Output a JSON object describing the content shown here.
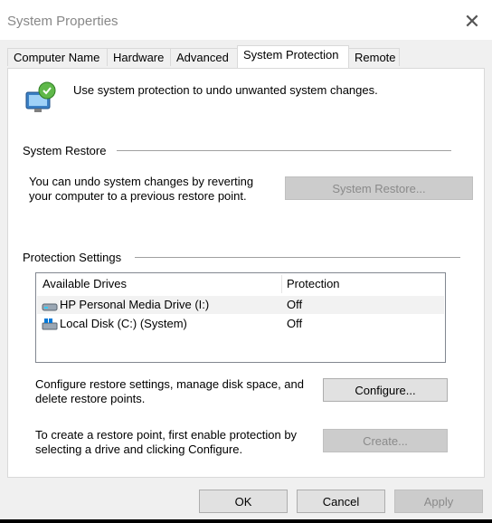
{
  "window": {
    "title": "System Properties"
  },
  "tabs": [
    {
      "label": "Computer Name"
    },
    {
      "label": "Hardware"
    },
    {
      "label": "Advanced"
    },
    {
      "label": "System Protection"
    },
    {
      "label": "Remote"
    }
  ],
  "header": {
    "text": "Use system protection to undo unwanted system changes."
  },
  "restore": {
    "group_label": "System Restore",
    "desc_line1": "You can undo system changes by reverting",
    "desc_line2": "your computer to a previous restore point.",
    "button_label": "System Restore..."
  },
  "protection": {
    "group_label": "Protection Settings",
    "col_drives": "Available Drives",
    "col_protection": "Protection",
    "drives": [
      {
        "name": "HP Personal Media Drive (I:)",
        "protection": "Off",
        "icon": "removable-drive-icon"
      },
      {
        "name": "Local Disk (C:) (System)",
        "protection": "Off",
        "icon": "system-drive-icon"
      }
    ],
    "configure_line1": "Configure restore settings, manage disk space, and",
    "configure_line2": "delete restore points.",
    "configure_button": "Configure...",
    "create_line1": "To create a restore point, first enable protection by",
    "create_line2": "selecting a drive and clicking Configure.",
    "create_button": "Create..."
  },
  "footer": {
    "ok": "OK",
    "cancel": "Cancel",
    "apply": "Apply"
  }
}
